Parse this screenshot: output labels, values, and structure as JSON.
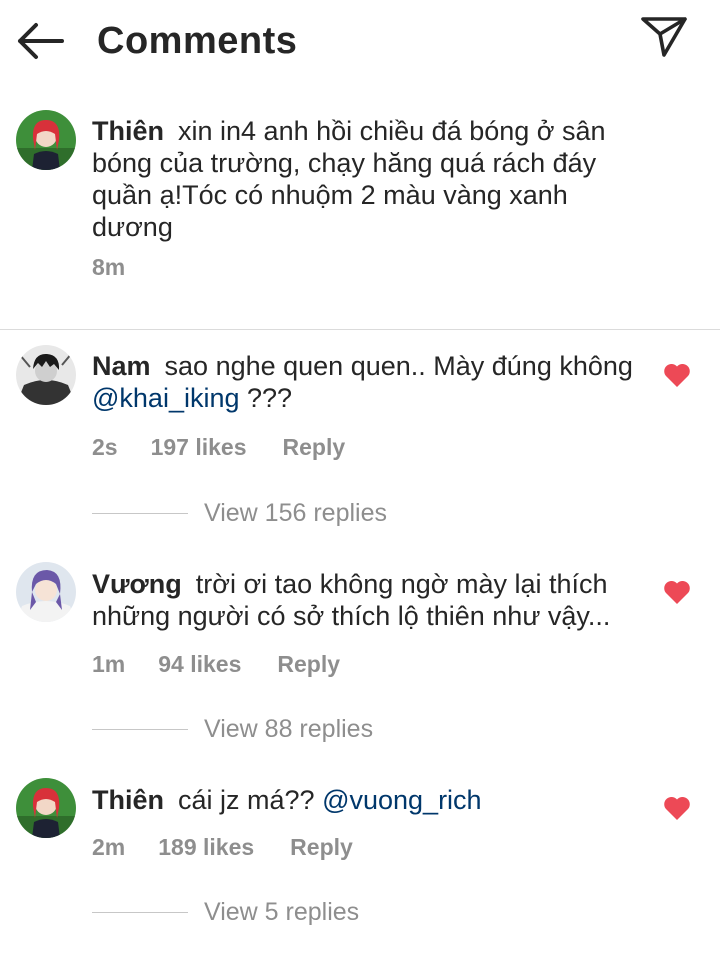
{
  "header": {
    "title": "Comments",
    "back_icon": "arrow-left-icon",
    "share_icon": "paper-plane-icon"
  },
  "caption": {
    "username": "Thiên",
    "text": "xin in4 anh hồi chiều đá bóng ở sân bóng của trường, chạy hăng quá rách đáy quần ạ!Tóc có nhuộm 2 màu vàng xanh dương",
    "time": "8m"
  },
  "comments": [
    {
      "username": "Nam",
      "text": "sao nghe quen quen.. Mày đúng không",
      "mention": "@khai_iking",
      "suffix": " ???",
      "time": "2s",
      "likes": "197 likes",
      "reply_label": "Reply",
      "view_replies": "View 156 replies",
      "liked": true
    },
    {
      "username": "Vương",
      "text": "trời ơi tao không ngờ mày lại thích những người có sở thích lộ thiên như vậy...",
      "time": "1m",
      "likes": "94 likes",
      "reply_label": "Reply",
      "view_replies": "View 88 replies",
      "liked": true
    },
    {
      "username": "Thiên",
      "text": "cái jz má??",
      "mention": "@vuong_rich",
      "time": "2m",
      "likes": "189 likes",
      "reply_label": "Reply",
      "view_replies": "View 5 replies",
      "liked": true
    }
  ],
  "colors": {
    "text": "#262626",
    "secondary": "#8e8e8e",
    "mention": "#00376b",
    "heart": "#ed4956",
    "divider": "#dbdbdb"
  }
}
